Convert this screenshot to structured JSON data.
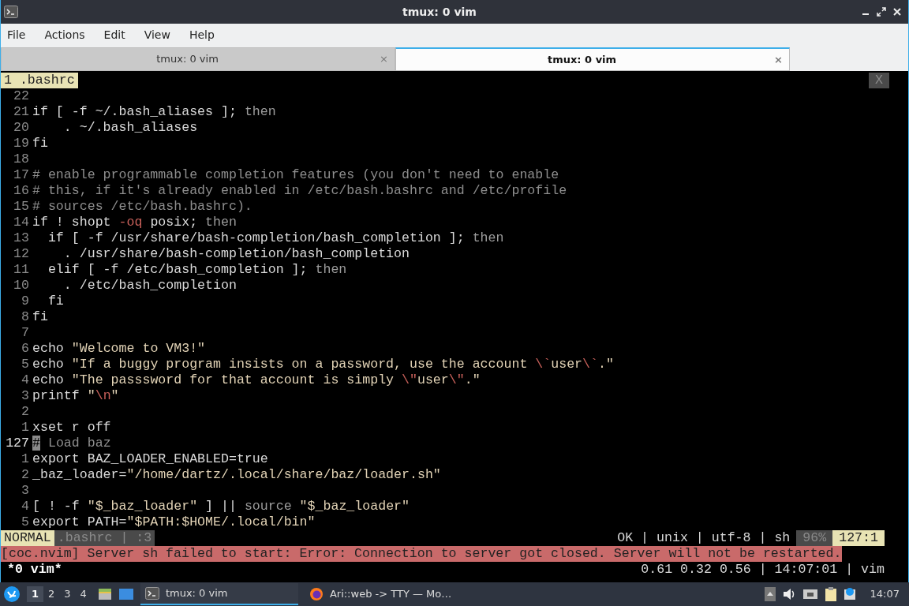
{
  "window": {
    "title": "tmux: 0 vim"
  },
  "menu": [
    "File",
    "Actions",
    "Edit",
    "View",
    "Help"
  ],
  "tabs": [
    {
      "label": "tmux: 0 vim",
      "close": "×",
      "selected": false
    },
    {
      "label": "tmux: 0 vim",
      "close": "×",
      "selected": true
    }
  ],
  "tabline": {
    "buffer": "1 .bashrc",
    "close": "X"
  },
  "lines": [
    {
      "number": "22"
    },
    {
      "number": "21",
      "segments": [
        {
          "kind": "plain",
          "text": "if [ -f ~/.bash_aliases ]; "
        },
        {
          "kind": "dim",
          "text": "then"
        }
      ]
    },
    {
      "number": "20",
      "segments": [
        {
          "kind": "plain",
          "text": "    . ~/.bash_aliases"
        }
      ]
    },
    {
      "number": "19",
      "segments": [
        {
          "kind": "plain",
          "text": "fi"
        }
      ]
    },
    {
      "number": "18"
    },
    {
      "number": "17",
      "segments": [
        {
          "kind": "comment",
          "text": "# enable programmable completion features (you don't need to enable"
        }
      ]
    },
    {
      "number": "16",
      "segments": [
        {
          "kind": "comment",
          "text": "# this, if it's already enabled in /etc/bash.bashrc and /etc/profile"
        }
      ]
    },
    {
      "number": "15",
      "segments": [
        {
          "kind": "comment",
          "text": "# sources /etc/bash.bashrc)."
        }
      ]
    },
    {
      "number": "14",
      "segments": [
        {
          "kind": "plain",
          "text": "if ! shopt "
        },
        {
          "kind": "special",
          "text": "-oq"
        },
        {
          "kind": "plain",
          "text": " posix; "
        },
        {
          "kind": "dim",
          "text": "then"
        }
      ]
    },
    {
      "number": "13",
      "segments": [
        {
          "kind": "plain",
          "text": "  if [ -f /usr/share/bash-completion/bash_completion ]; "
        },
        {
          "kind": "dim",
          "text": "then"
        }
      ]
    },
    {
      "number": "12",
      "segments": [
        {
          "kind": "plain",
          "text": "    . /usr/share/bash-completion/bash_completion"
        }
      ]
    },
    {
      "number": "11",
      "segments": [
        {
          "kind": "plain",
          "text": "  elif [ -f /etc/bash_completion ]; "
        },
        {
          "kind": "dim",
          "text": "then"
        }
      ]
    },
    {
      "number": "10",
      "segments": [
        {
          "kind": "plain",
          "text": "    . /etc/bash_completion"
        }
      ]
    },
    {
      "number": "9",
      "segments": [
        {
          "kind": "plain",
          "text": "  fi"
        }
      ]
    },
    {
      "number": "8",
      "segments": [
        {
          "kind": "plain",
          "text": "fi"
        }
      ]
    },
    {
      "number": "7"
    },
    {
      "number": "6",
      "segments": [
        {
          "kind": "plain",
          "text": "echo "
        },
        {
          "kind": "string",
          "text": "\"Welcome to VM3!\""
        }
      ]
    },
    {
      "number": "5",
      "segments": [
        {
          "kind": "plain",
          "text": "echo "
        },
        {
          "kind": "string",
          "text": "\"If a buggy program insists on a password, use the account "
        },
        {
          "kind": "special",
          "text": "\\`"
        },
        {
          "kind": "string",
          "text": "user"
        },
        {
          "kind": "special",
          "text": "\\`"
        },
        {
          "kind": "string",
          "text": ".\""
        }
      ]
    },
    {
      "number": "4",
      "segments": [
        {
          "kind": "plain",
          "text": "echo "
        },
        {
          "kind": "string",
          "text": "\"The passsword for that account is simply "
        },
        {
          "kind": "special",
          "text": "\\\""
        },
        {
          "kind": "string",
          "text": "user"
        },
        {
          "kind": "special",
          "text": "\\\""
        },
        {
          "kind": "string",
          "text": ".\""
        }
      ]
    },
    {
      "number": "3",
      "segments": [
        {
          "kind": "plain",
          "text": "printf "
        },
        {
          "kind": "string",
          "text": "\""
        },
        {
          "kind": "special",
          "text": "\\n"
        },
        {
          "kind": "string",
          "text": "\""
        }
      ]
    },
    {
      "number": "2"
    },
    {
      "number": "1",
      "segments": [
        {
          "kind": "plain",
          "text": "xset r off"
        }
      ]
    },
    {
      "number": "127",
      "current": true,
      "segments": [
        {
          "kind": "cursor",
          "text": "#"
        },
        {
          "kind": "comment",
          "text": " Load baz"
        }
      ]
    },
    {
      "number": "1",
      "segments": [
        {
          "kind": "plain",
          "text": "export BAZ_LOADER_ENABLED=true"
        }
      ]
    },
    {
      "number": "2",
      "segments": [
        {
          "kind": "plain",
          "text": "_baz_loader="
        },
        {
          "kind": "string",
          "text": "\"/home/dartz/.local/share/baz/loader.sh\""
        }
      ]
    },
    {
      "number": "3"
    },
    {
      "number": "4",
      "segments": [
        {
          "kind": "plain",
          "text": "[ ! -f "
        },
        {
          "kind": "string",
          "text": "\"$_baz_loader\""
        },
        {
          "kind": "plain",
          "text": " ] || "
        },
        {
          "kind": "dim",
          "text": "source"
        },
        {
          "kind": "string",
          "text": " \"$_baz_loader\""
        }
      ]
    },
    {
      "number": "5",
      "segments": [
        {
          "kind": "plain",
          "text": "export PATH="
        },
        {
          "kind": "string",
          "text": "\"$PATH:$HOME/.local/bin\""
        }
      ]
    }
  ],
  "statusline": {
    "mode": "NORMAL",
    "file": ".bashrc | :3",
    "info": "OK | unix | utf-8 | sh",
    "percent": "96%",
    "position": "127:1"
  },
  "message": "[coc.nvim] Server sh failed to start: Error: Connection to server got closed. Server will not be restarted.",
  "tmux_status": {
    "window": "*0 vim*",
    "right": "0.61 0.32 0.56 | 14:07:01 | vim"
  },
  "taskbar": {
    "workspaces": [
      {
        "label": "1",
        "selected": true
      },
      {
        "label": "2",
        "selected": false
      },
      {
        "label": "3",
        "selected": false
      },
      {
        "label": "4",
        "selected": false
      }
    ],
    "tasks": [
      {
        "kind": "terminal",
        "label": "tmux: 0 vim",
        "selected": true
      },
      {
        "kind": "browser",
        "label": "Ari::web -> TTY — Mo…",
        "selected": false
      }
    ],
    "clock": "14:07"
  }
}
